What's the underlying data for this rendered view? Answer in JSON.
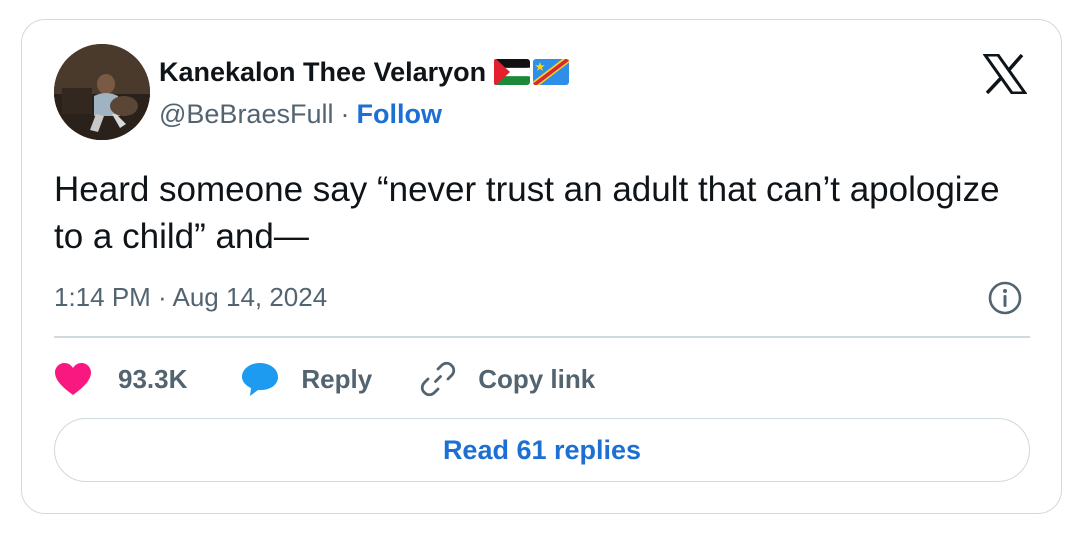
{
  "author": {
    "display_name": "Kanekalon Thee Velaryon",
    "handle": "@BeBraesFull",
    "separator": "·",
    "follow_label": "Follow",
    "flags": [
      "palestine-flag-icon",
      "dr-congo-flag-icon"
    ]
  },
  "tweet": {
    "text": "Heard someone say “never trust an adult that can’t apologize to a child” and—",
    "timestamp": "1:14 PM · Aug 14, 2024"
  },
  "actions": {
    "like_count": "93.3K",
    "reply_label": "Reply",
    "copy_link_label": "Copy link"
  },
  "read_replies_label": "Read 61 replies",
  "icons": {
    "logo": "x-logo-icon",
    "info": "info-icon",
    "like": "heart-icon",
    "reply": "speech-bubble-icon",
    "copy": "link-icon"
  },
  "colors": {
    "link_blue": "#1d6fd3",
    "like_pink": "#f91880",
    "reply_blue": "#1d9bf0",
    "secondary_text": "#536471",
    "border": "#cfd9de"
  }
}
